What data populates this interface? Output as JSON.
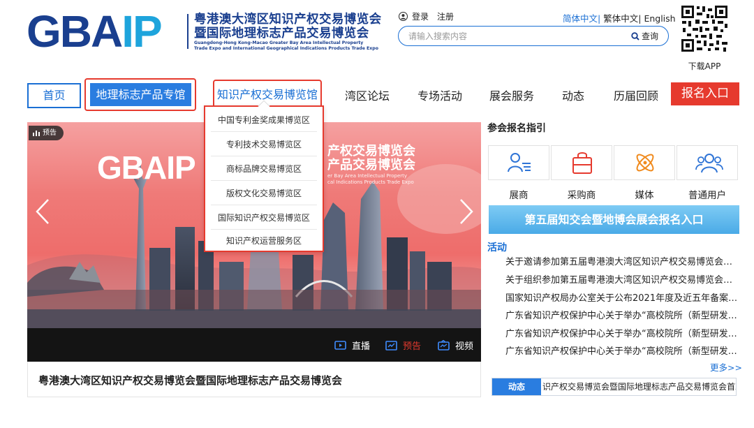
{
  "header": {
    "logo_main": "GBA",
    "logo_accent": "IP",
    "title_cn_line1": "粤港澳大湾区知识产权交易博览会",
    "title_cn_line2": "暨国际地理标志产品交易博览会",
    "title_en_line1": "Guangdong-Hong Kong-Macao Greater Bay Area Intellectual Property",
    "title_en_line2": "Trade Expo and International Geographical Indications Products Trade Expo",
    "login": "登录",
    "register": "注册",
    "lang_simplified": "简体中文",
    "lang_separator1": "|",
    "lang_traditional": "繁体中文",
    "lang_separator2": "|",
    "lang_english": "English",
    "search_placeholder": "请输入搜索内容",
    "search_button": "查询",
    "qr_label": "下载APP"
  },
  "nav": {
    "home": "首页",
    "geo_pavilion": "地理标志产品专馆",
    "ip_pavilion": "知识产权交易博览馆",
    "forum": "湾区论坛",
    "events": "专场活动",
    "services": "展会服务",
    "news": "动态",
    "history": "历届回顾",
    "apply": "报名入口"
  },
  "dropdown": {
    "items": [
      "中国专利金奖成果博览区",
      "专利技术交易博览区",
      "商标品牌交易博览区",
      "版权文化交易博览区",
      "国际知识产权交易博览区",
      "知识产权运营服务区"
    ]
  },
  "banner": {
    "badge": "预告",
    "logo_main": "GBA",
    "logo_accent": "IP",
    "title_line1": "产权交易博览会",
    "title_line2": "产品交易博览会",
    "sub_line1": "er Bay Area Intellectual Property",
    "sub_line2": "cal Indications Products Trade Expo",
    "bar_live": "直播",
    "bar_preview": "预告",
    "bar_video": "视频",
    "caption": "粤港澳大湾区知识产权交易博览会暨国际地理标志产品交易博览会"
  },
  "guide": {
    "title": "参会报名指引",
    "roles": [
      {
        "label": "展商",
        "icon": "exhibitor-icon"
      },
      {
        "label": "采购商",
        "icon": "buyer-icon"
      },
      {
        "label": "媒体",
        "icon": "media-icon"
      },
      {
        "label": "普通用户",
        "icon": "users-icon"
      }
    ],
    "register_banner": "第五届知交会暨地博会展会报名入口"
  },
  "activities": {
    "title": "活动",
    "items": [
      "关于邀请参加第五届粤港澳大湾区知识产权交易博览会暨国际地理标志产品交易博览会的通知",
      "关于组织参加第五届粤港澳大湾区知识产权交易博览会暨国际地理标志产品交易博览会的通知",
      "国家知识产权局办公室关于公布2021年度及近五年备案的通知",
      "广东省知识产权保护中心关于举办“高校院所（新型研发机构）”专场活动的通知",
      "广东省知识产权保护中心关于举办“高校院所（新型研发机构）”专场活动的通知",
      "广东省知识产权保护中心关于举办“高校院所（新型研发机构）”专场活动的通知"
    ],
    "more": "更多>>"
  },
  "ticker": {
    "label": "动态",
    "text": "识产权交易博览会暨国际地理标志产品交易博览会首次"
  },
  "colors": {
    "brand_blue": "#1a3f8f",
    "accent_blue": "#1a6fd4",
    "accent_red": "#e63a2e",
    "banner_sky": "#ef7a78"
  }
}
